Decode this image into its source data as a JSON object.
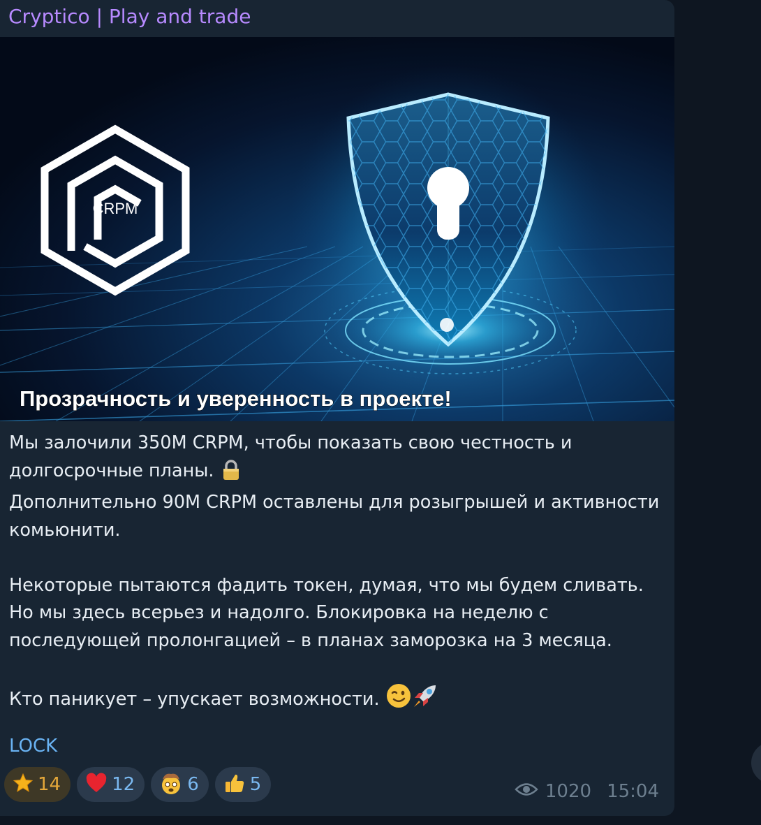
{
  "channel": {
    "name": "Cryptico | Play and trade"
  },
  "image": {
    "logo_text": "CRPM",
    "caption": "Прозрачность и уверенность в проекте!"
  },
  "message": {
    "line1": "Мы залочили 350M CRPM, чтобы показать свою честность и долгосрочные планы.",
    "line1_emoji": "lock-emoji",
    "line2": "Дополнительно 90M CRPM оставлены для розыгрышей и активности комьюнити.",
    "para2": "Некоторые пытаются фадить токен, думая, что мы будем сливать. Но мы здесь всерьез и надолго. Блокировка на неделю с последующей пролонгацией – в планах заморозка на 3 месяца.",
    "para3": "Кто паникует – упускает возможности.",
    "para3_emojis": [
      "wink-emoji",
      "rocket-emoji"
    ],
    "hashtag": "LOCK"
  },
  "reactions": [
    {
      "icon": "star-icon",
      "count": "14"
    },
    {
      "icon": "heart-icon",
      "count": "12"
    },
    {
      "icon": "mind-blown-icon",
      "count": "6"
    },
    {
      "icon": "thumbs-up-icon",
      "count": "5"
    }
  ],
  "meta": {
    "views": "1020",
    "time": "15:04"
  },
  "colors": {
    "background": "#0e1621",
    "bubble": "#182533",
    "channel_name": "#b78aff",
    "link": "#6ab3f3",
    "paid_reaction": "#e5a83a"
  }
}
